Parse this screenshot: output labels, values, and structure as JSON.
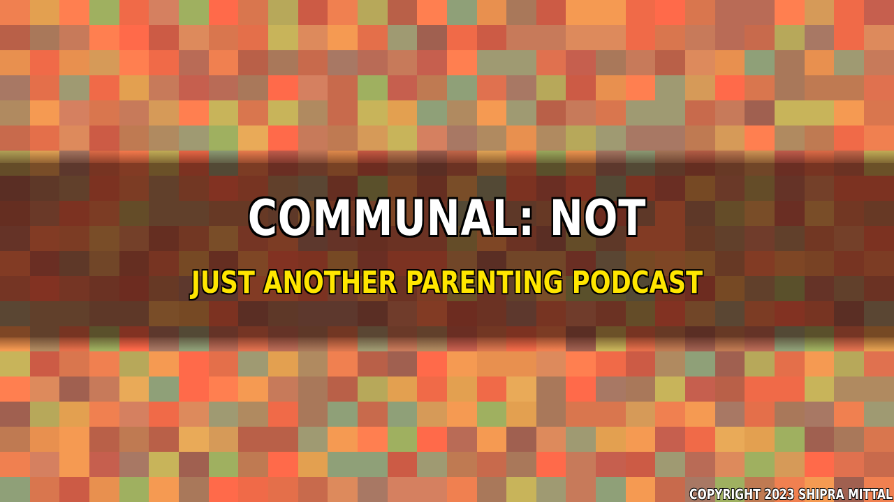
{
  "title": "COMMUNAL: NOT",
  "subtitle": "JUST ANOTHER PARENTING PODCAST",
  "copyright": "COPYRIGHT 2023 SHIPRA MITTAL",
  "colors": {
    "title_text": "#ffffff",
    "subtitle_text": "#ffe600",
    "outline": "#000000",
    "band_overlay": "rgba(40, 10, 5, 0.58)",
    "mosaic_palette": [
      "#e0714f",
      "#f08050",
      "#c86a4c",
      "#d9764e",
      "#b96048",
      "#e8904f",
      "#f59a52",
      "#cc5b45",
      "#a9785a",
      "#bf7a52",
      "#dd8a5c",
      "#f06a48",
      "#e46f4a",
      "#d69a58",
      "#b7a85a",
      "#8fa078",
      "#9f9a72",
      "#c8b45a",
      "#a06050",
      "#ff6a4a",
      "#e3a050",
      "#c77a5a",
      "#b96b56",
      "#d58060",
      "#9fb060",
      "#e9aa58",
      "#b08a60",
      "#a87864",
      "#ff7f50",
      "#c65f4e"
    ]
  }
}
